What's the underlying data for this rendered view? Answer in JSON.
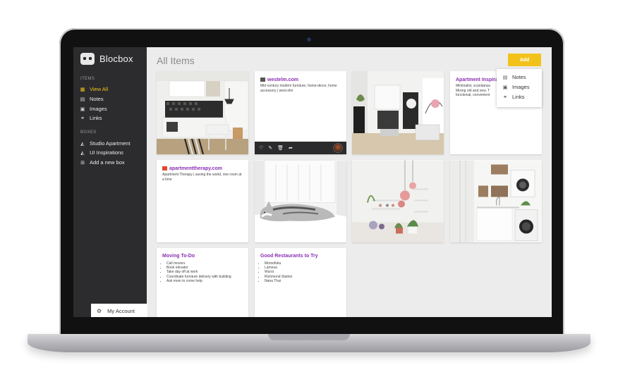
{
  "app": {
    "name": "Blocbox"
  },
  "sidebar": {
    "items_label": "ITEMS",
    "items": [
      {
        "label": "View All",
        "icon": "grid-icon",
        "active": true
      },
      {
        "label": "Notes",
        "icon": "note-icon"
      },
      {
        "label": "Images",
        "icon": "image-icon"
      },
      {
        "label": "Links",
        "icon": "link-icon"
      }
    ],
    "boxes_label": "BOXES",
    "boxes": [
      {
        "label": "Studio Apartment",
        "icon": "box-icon"
      },
      {
        "label": "UI Inspirations",
        "icon": "box-icon"
      },
      {
        "label": "Add a new box",
        "icon": "plus-icon"
      }
    ],
    "account_label": "My Account"
  },
  "main": {
    "title": "All Items",
    "add_label": "Add",
    "add_menu": [
      "Notes",
      "Images",
      "Links"
    ]
  },
  "cards": {
    "westelm": {
      "title": "westelm.com",
      "text": "Mid-century modern furniture, home-decor, home accessory | west elm"
    },
    "apartment_inspiration": {
      "title": "Apartment Inspira",
      "text": "Minimalist, scandanav Mixing old and new. T functional, convenient"
    },
    "apartmenttherapy": {
      "title": "apartmenttherapy.com",
      "text": "Apartment Therapy | saving the world, one room at a time"
    },
    "moving": {
      "title": "Moving To-Do",
      "items": [
        "Call movers",
        "Book elevator",
        "Take day off at work",
        "Coordinate furniture delivery with building",
        "Ask mom to come help"
      ]
    },
    "restaurants": {
      "title": "Good Restaurants to Try",
      "items": [
        "Momofuku",
        "Lamesa",
        "Wurst",
        "Richmond Station",
        "Nana Thai"
      ]
    }
  },
  "colors": {
    "accent": "#f2c21a",
    "link_title": "#8a2fb2",
    "sidebar_bg": "#2c2c2e",
    "active_nav": "#f3c419"
  }
}
